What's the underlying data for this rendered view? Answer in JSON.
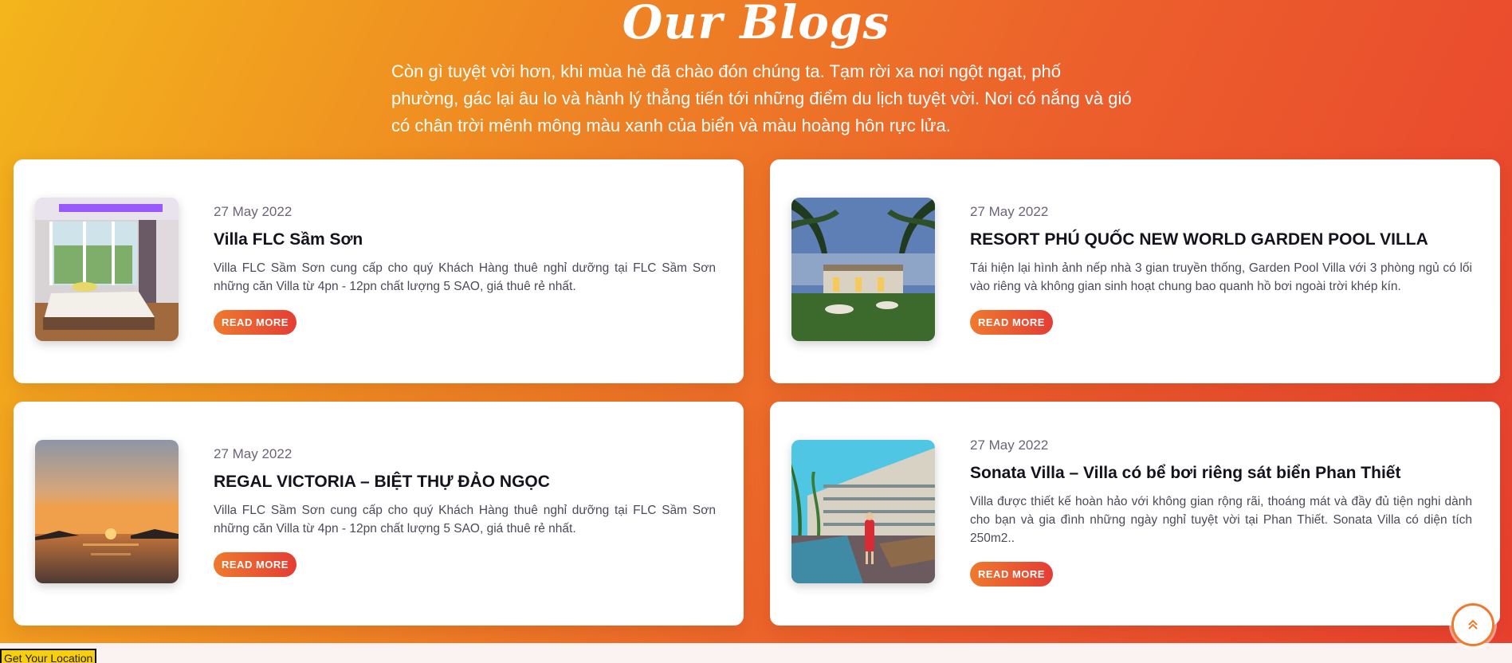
{
  "section": {
    "title": "Our Blogs",
    "intro": "Còn gì tuyệt vời hơn, khi mùa hè đã chào đón chúng ta. Tạm rời xa nơi ngột ngạt, phố phường, gác lại âu lo và hành lý thẳng tiến tới những điểm du lịch tuyệt vời. Nơi có nắng và gió có chân trời mênh mông màu xanh của biển và màu hoàng hôn rực lửa."
  },
  "posts": [
    {
      "date": "27 May 2022",
      "title": "Villa FLC Sầm Sơn",
      "excerpt": "Villa FLC Sầm Sơn cung cấp cho quý Khách Hàng thuê nghỉ dưỡng tại FLC Sầm Sơn những căn Villa từ 4pn - 12pn chất lượng 5 SAO, giá thuê rẻ nhất.",
      "button": "READ MORE",
      "image": "villa-bedroom"
    },
    {
      "date": "27 May 2022",
      "title": "RESORT PHÚ QUỐC NEW WORLD GARDEN POOL VILLA",
      "excerpt": "Tái hiện lại hình ảnh nếp nhà 3 gian truyền thống, Garden Pool Villa với 3 phòng ngủ có lối vào riêng và không gian sinh hoạt chung bao quanh hồ bơi ngoài trời khép kín.",
      "button": "READ MORE",
      "image": "resort-garden-palms"
    },
    {
      "date": "27 May 2022",
      "title": "REGAL VICTORIA – BIỆT THỰ ĐẢO NGỌC",
      "excerpt": "Villa FLC Sầm Sơn cung cấp cho quý Khách Hàng thuê nghỉ dưỡng tại FLC Sầm Sơn những căn Villa từ 4pn - 12pn chất lượng 5 SAO, giá thuê rẻ nhất.",
      "button": "READ MORE",
      "image": "sunset-sea"
    },
    {
      "date": "27 May 2022",
      "title": "Sonata Villa – Villa có bể bơi riêng sát biển Phan Thiết",
      "excerpt": "Villa được thiết kế hoàn hảo với không gian rộng rãi, thoáng mát và đầy đủ tiện nghi dành cho bạn và gia đình những ngày nghỉ tuyệt vời tại Phan Thiết. Sonata Villa có diện tích 250m2..",
      "button": "READ MORE",
      "image": "hotel-pool-woman"
    }
  ],
  "scroll_top": {
    "icon": "double-chevron-up-icon"
  },
  "location_button": {
    "label": "Get Your Location"
  },
  "colors": {
    "accent": "#ef7a2e",
    "accent_dark": "#e43d35",
    "card": "#ffffff"
  }
}
